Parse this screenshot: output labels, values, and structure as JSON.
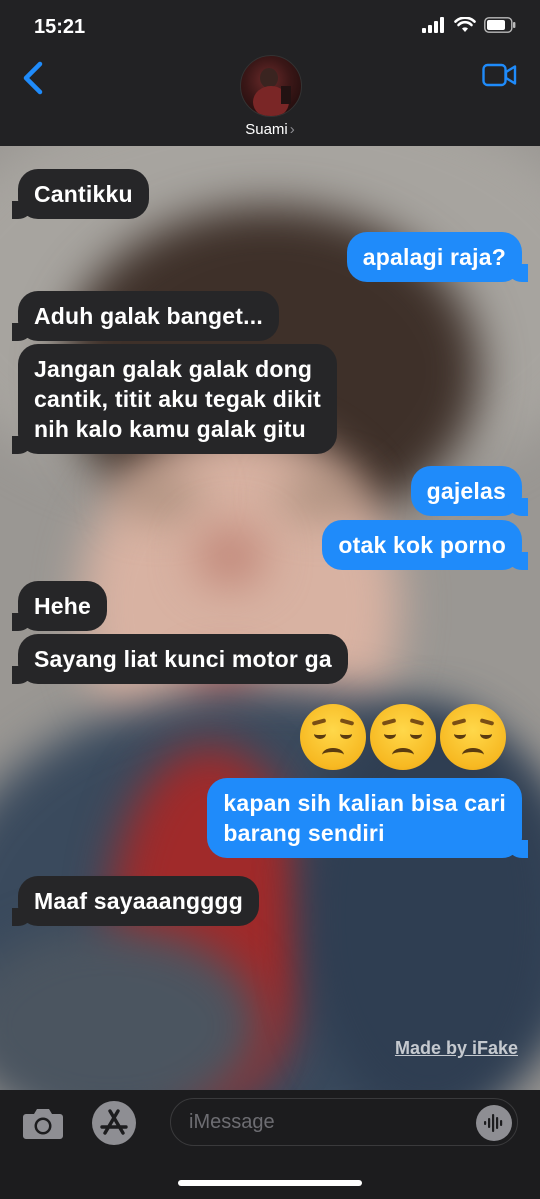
{
  "status": {
    "time": "15:21"
  },
  "header": {
    "contact_name": "Suami",
    "chevron": "›"
  },
  "messages": [
    {
      "side": "received",
      "text": "Cantikku"
    },
    {
      "side": "sent",
      "text": "apalagi raja?"
    },
    {
      "side": "received",
      "text": "Aduh galak banget..."
    },
    {
      "side": "received",
      "text": "Jangan galak galak dong\ncantik, titit aku tegak dikit\nnih kalo kamu galak gitu"
    },
    {
      "side": "sent",
      "text": "gajelas"
    },
    {
      "side": "sent",
      "text": "otak kok porno"
    },
    {
      "side": "received",
      "text": "Hehe"
    },
    {
      "side": "received",
      "text": "Sayang liat kunci motor ga"
    },
    {
      "side": "sent",
      "text": "kapan sih kalian bisa cari\nbarang sendiri"
    },
    {
      "side": "received",
      "text": "Maaf sayaaangggg"
    }
  ],
  "emoji_message": {
    "side": "sent",
    "emojis": [
      "disappointed-face",
      "disappointed-face",
      "disappointed-face"
    ]
  },
  "watermark": "Made by iFake",
  "input": {
    "placeholder": "iMessage",
    "value": ""
  },
  "icons": {
    "back": "chevron-left-icon",
    "video": "video-camera-icon",
    "camera": "camera-icon",
    "apps": "app-store-icon",
    "audio": "audio-waveform-icon"
  },
  "colors": {
    "accent": "#1f8bfa",
    "received_bubble": "#262628",
    "bar": "#222224"
  }
}
